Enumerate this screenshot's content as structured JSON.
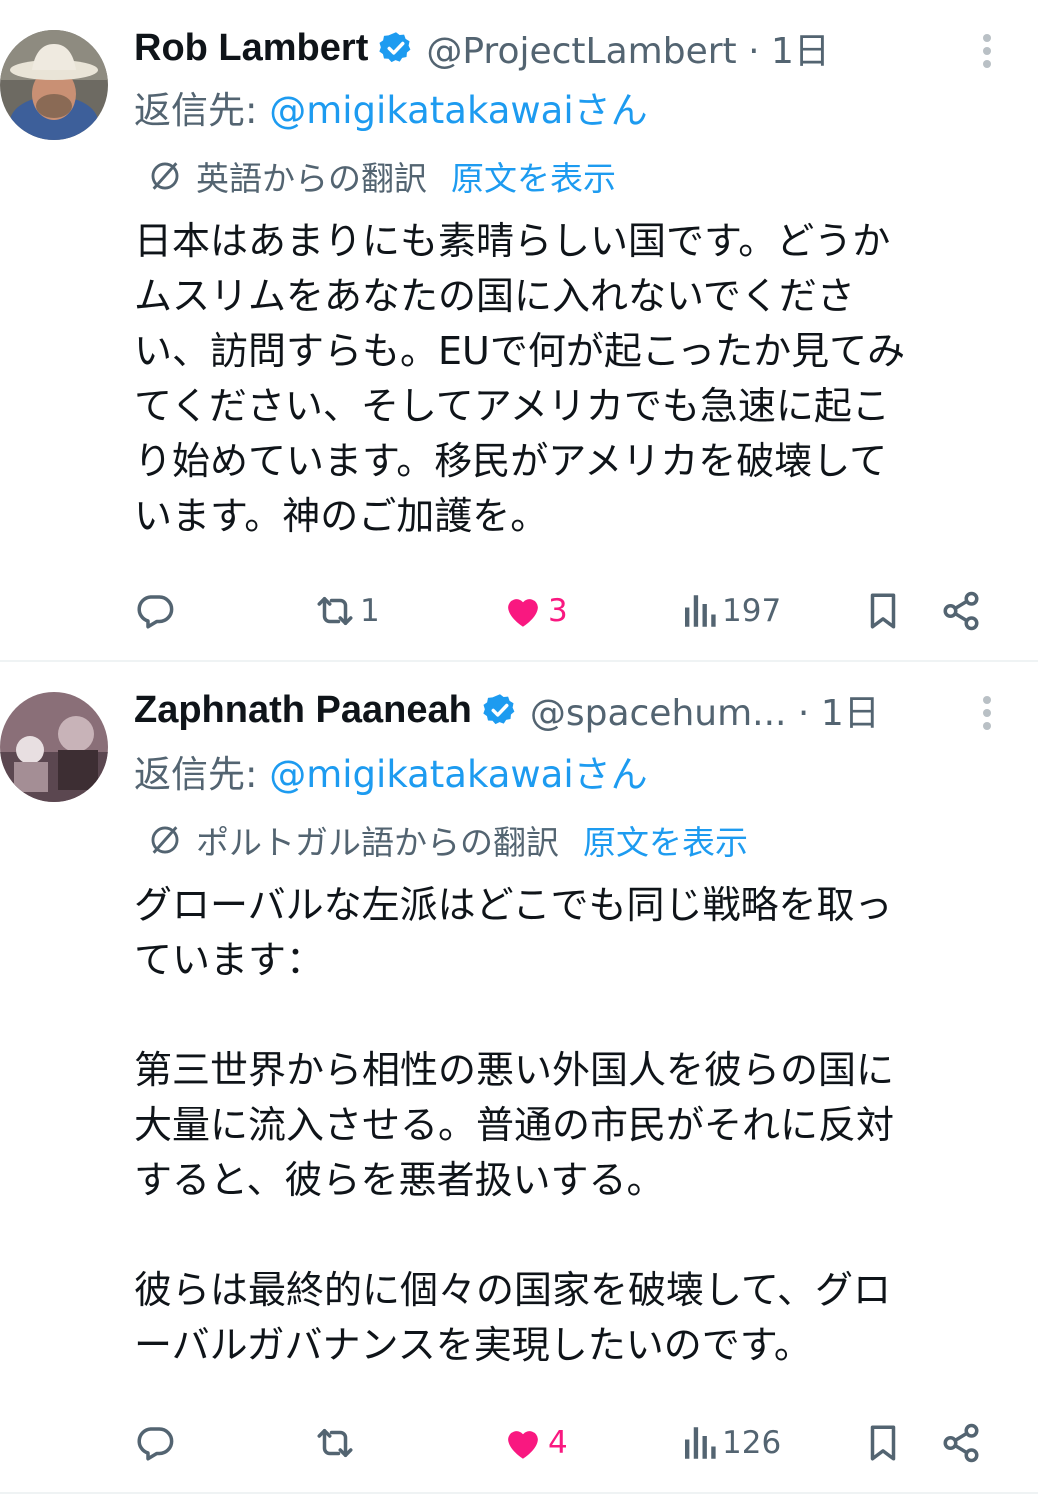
{
  "posts": [
    {
      "author_name": "Rob Lambert",
      "handle": "@ProjectLambert · 1日",
      "reply_prefix": "返信先: ",
      "reply_to": "@migikatakawaiさん",
      "translation_label": "英語からの翻訳",
      "show_original": "原文を表示",
      "text": "日本はあまりにも素晴らしい国です。どうか\nムスリムをあなたの国に入れないでくださ\nい、訪問すらも。EUで何が起こったか見てみ\nてください、そしてアメリカでも急速に起こ\nり始めています。移民がアメリカを破壊して\nいます。神のご加護を。",
      "reply_count": "",
      "repost_count": "1",
      "like_count": "3",
      "view_count": "197"
    },
    {
      "author_name": "Zaphnath Paaneah",
      "handle": "@spacehum... · 1日",
      "reply_prefix": "返信先: ",
      "reply_to": "@migikatakawaiさん",
      "translation_label": "ポルトガル語からの翻訳",
      "show_original": "原文を表示",
      "text": "グローバルな左派はどこでも同じ戦略を取っ\nています：\n\n第三世界から相性の悪い外国人を彼らの国に\n大量に流入させる。普通の市民がそれに反対\nすると、彼らを悪者扱いする。\n\n彼らは最終的に個々の国家を破壊して、グロ\nーバルガバナンスを実現したいのです。",
      "reply_count": "",
      "repost_count": "",
      "like_count": "4",
      "view_count": "126"
    }
  ],
  "icons": [
    "verified-badge-icon",
    "more-icon",
    "translate-globe-icon",
    "reply-icon",
    "repost-icon",
    "like-icon",
    "views-icon",
    "bookmark-icon",
    "share-icon"
  ],
  "colors": {
    "accent": "#1d9bf0",
    "like": "#f91880",
    "muted": "#536471",
    "text": "#0f1419"
  }
}
